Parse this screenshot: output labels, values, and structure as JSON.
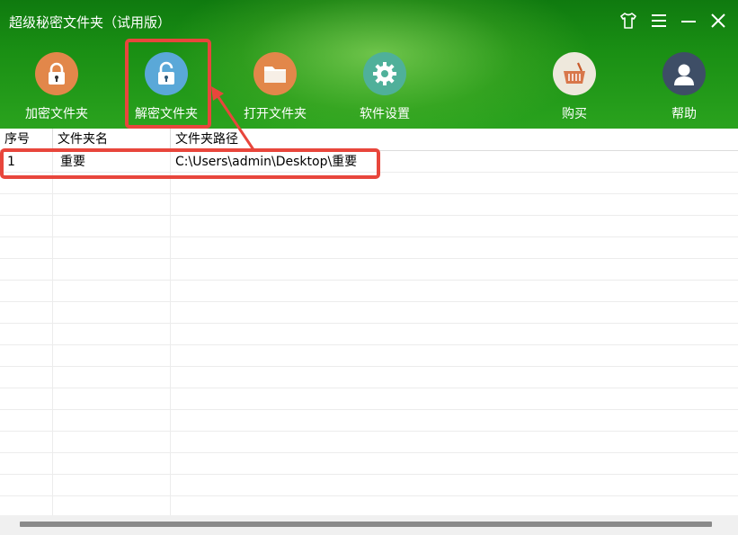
{
  "window": {
    "title": "超级秘密文件夹（试用版）",
    "controls": {
      "skin": "👕",
      "menu": "☰",
      "minimize": "—",
      "close": "✕"
    }
  },
  "toolbar": {
    "items": [
      {
        "label": "加密文件夹",
        "icon": "lock-closed-icon",
        "color": "#e2874a"
      },
      {
        "label": "解密文件夹",
        "icon": "lock-open-icon",
        "color": "#5aa8d8"
      },
      {
        "label": "打开文件夹",
        "icon": "folder-icon",
        "color": "#e2874a"
      },
      {
        "label": "软件设置",
        "icon": "gear-icon",
        "color": "#4fb09a"
      },
      {
        "label": "购买",
        "icon": "basket-icon",
        "color": "#eee8dc"
      },
      {
        "label": "帮助",
        "icon": "user-icon",
        "color": "#3e4e66"
      }
    ]
  },
  "table": {
    "headers": [
      "序号",
      "文件夹名",
      "文件夹路径"
    ],
    "rows": [
      [
        "1",
        "重要",
        "C:\\Users\\admin\\Desktop\\重要"
      ]
    ]
  },
  "annotation": {
    "color": "#e8463c"
  }
}
